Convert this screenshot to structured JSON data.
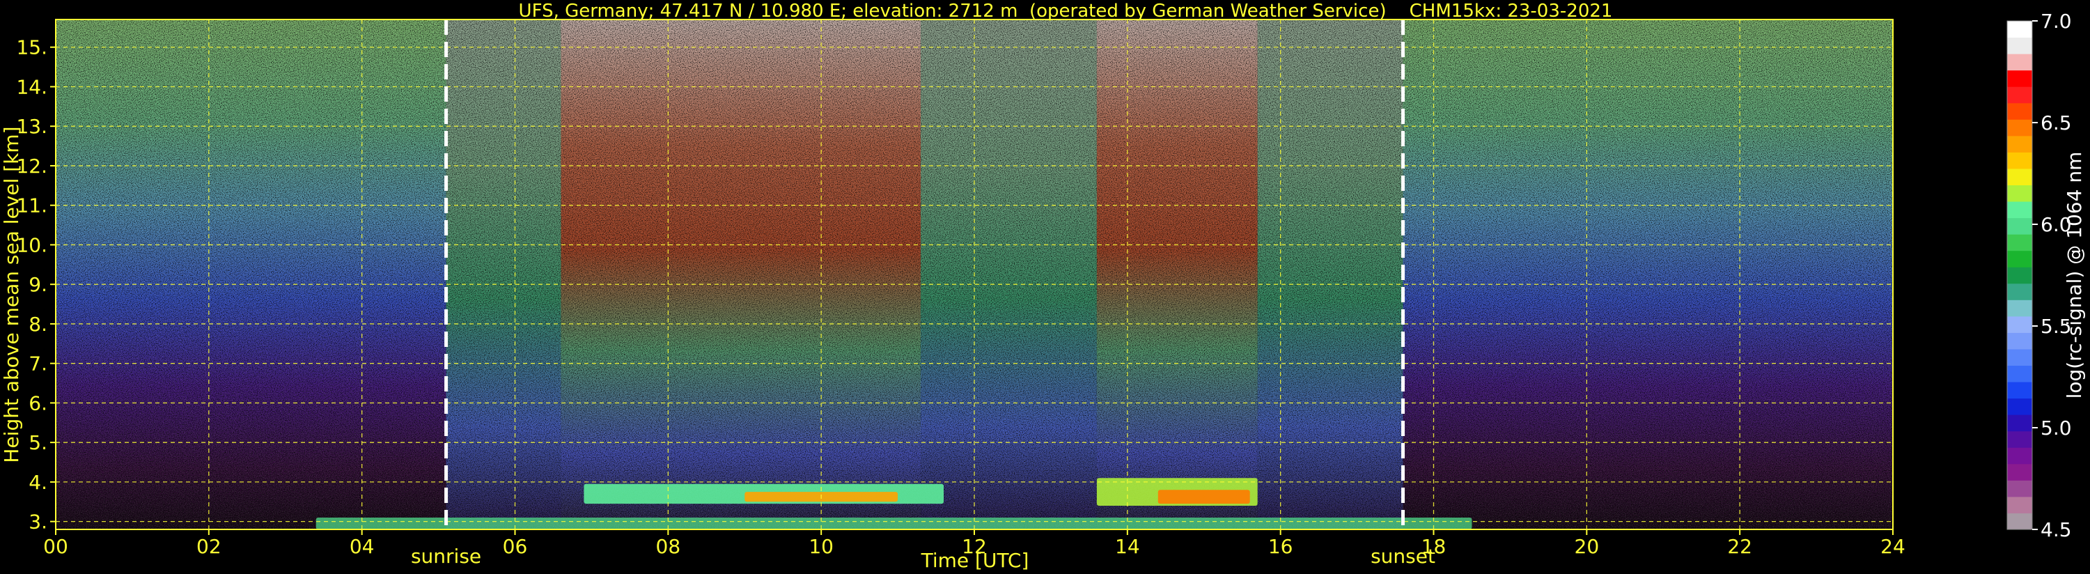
{
  "chart_data": {
    "type": "heatmap",
    "title": "UFS, Germany; 47.417 N / 10.980 E; elevation: 2712 m  (operated by German Weather Service)    CHM15kx: 23-03-2021",
    "xlabel": "Time [UTC]",
    "ylabel": "Height above mean sea level [km]",
    "xlim": [
      0,
      24
    ],
    "ylim": [
      2.8,
      15.7
    ],
    "x_ticks": [
      "00",
      "02",
      "04",
      "06",
      "08",
      "10",
      "12",
      "14",
      "16",
      "18",
      "20",
      "22",
      "24"
    ],
    "y_ticks": [
      "3.",
      "4.",
      "5.",
      "6.",
      "7.",
      "8.",
      "9.",
      "10.",
      "11.",
      "12.",
      "13.",
      "14.",
      "15."
    ],
    "grid": true,
    "annotations": [
      {
        "label": "sunrise",
        "x": 5.1
      },
      {
        "label": "sunset",
        "x": 17.6
      }
    ],
    "colorbar": {
      "label": "log(rc-signal) @ 1064 nm",
      "min": 4.5,
      "max": 7.0,
      "ticks": [
        "4.5",
        "5.0",
        "5.5",
        "6.0",
        "6.5",
        "7.0"
      ],
      "colors": [
        "#a89aa5",
        "#b67a9d",
        "#9a4a96",
        "#8a1b8f",
        "#75129a",
        "#5410a3",
        "#2c10b5",
        "#1224d8",
        "#1a46f2",
        "#3a6cf8",
        "#5a86fa",
        "#7a9cfa",
        "#96b2fa",
        "#7ac4cc",
        "#37a888",
        "#169a4a",
        "#1ab52f",
        "#3ccb52",
        "#4fdc8b",
        "#5ef09b",
        "#aef03a",
        "#f5ef14",
        "#ffc800",
        "#ffa200",
        "#ff7a00",
        "#ff4a00",
        "#ff2020",
        "#ff0000",
        "#f5b4b4",
        "#ececec",
        "#ffffff"
      ]
    },
    "signal_regions": [
      {
        "type": "cloud",
        "t0": 6.9,
        "t1": 11.6,
        "z0": 3.45,
        "z1": 3.95,
        "level": 6.1
      },
      {
        "type": "cloud_core",
        "t0": 9.0,
        "t1": 11.0,
        "z0": 3.5,
        "z1": 3.75,
        "level": 6.4
      },
      {
        "type": "cloud",
        "t0": 13.6,
        "t1": 15.7,
        "z0": 3.4,
        "z1": 4.1,
        "level": 6.2
      },
      {
        "type": "cloud_core",
        "t0": 14.4,
        "t1": 15.6,
        "z0": 3.45,
        "z1": 3.8,
        "level": 6.5
      },
      {
        "type": "boundary_layer",
        "t0": 3.4,
        "t1": 18.5,
        "z0": 2.8,
        "z1": 3.1,
        "level": 6.0
      }
    ]
  }
}
